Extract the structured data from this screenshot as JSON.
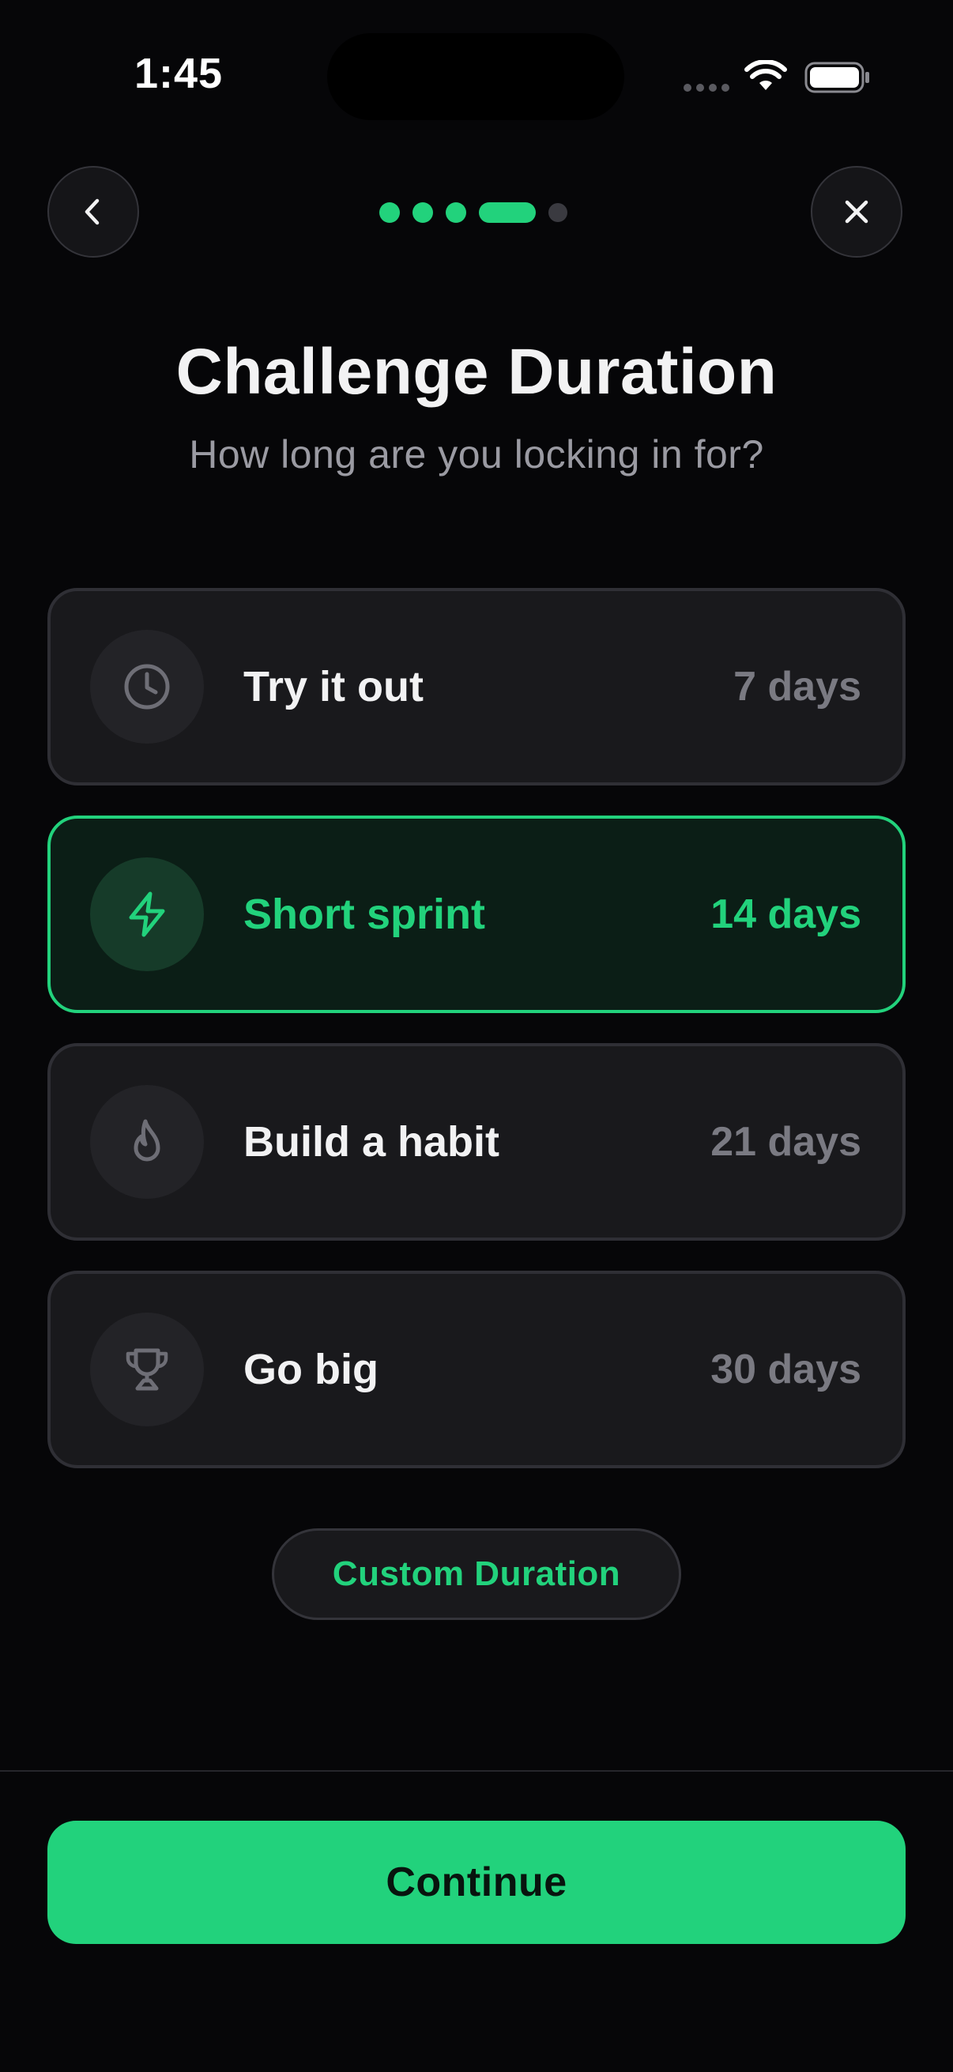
{
  "status_bar": {
    "time": "1:45"
  },
  "nav": {
    "back_icon": "chevron-left-icon",
    "close_icon": "close-icon",
    "progress": {
      "total_steps": 5,
      "current_step": 4
    }
  },
  "header": {
    "title": "Challenge Duration",
    "subtitle": "How long are you locking in for?"
  },
  "options": [
    {
      "icon": "clock-icon",
      "label": "Try it out",
      "days": "7 days",
      "selected": false
    },
    {
      "icon": "lightning-icon",
      "label": "Short sprint",
      "days": "14 days",
      "selected": true
    },
    {
      "icon": "flame-icon",
      "label": "Build a habit",
      "days": "21 days",
      "selected": false
    },
    {
      "icon": "trophy-icon",
      "label": "Go big",
      "days": "30 days",
      "selected": false
    }
  ],
  "custom_button": {
    "label": "Custom Duration"
  },
  "footer": {
    "continue_label": "Continue"
  },
  "colors": {
    "background": "#060608",
    "accent": "#22d27c",
    "card": "#19191c",
    "card_border": "#2f2f35",
    "selected_card": "#0b1e16",
    "muted_text": "#7a7a82"
  }
}
